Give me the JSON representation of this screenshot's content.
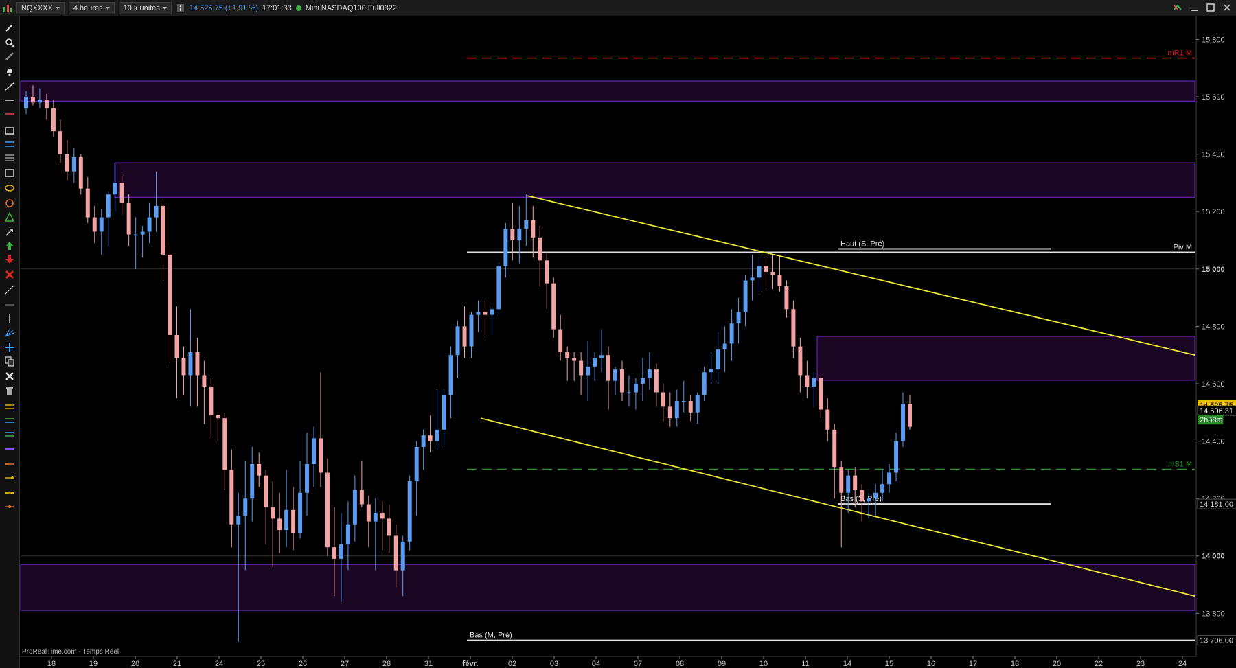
{
  "toolbar": {
    "instrument_code": "NQXXXX",
    "timeframe": "4 heures",
    "units": "10 k unités",
    "price_readout": "14 525,75 (+1,91 %)",
    "time_readout": "17:01:33",
    "instrument_name": "Mini NASDAQ100 Full0322"
  },
  "watermark": "ProRealTime.com - Temps Réel",
  "colors": {
    "background": "#000000",
    "bull": "#5b9cf0",
    "bear": "#f2a3a3",
    "zone_fill": "#1a0522",
    "zone_border": "#7a2ad0",
    "trendline": "#e8e830",
    "pivot_line": "#e0e0e0",
    "r1_line": "#d42020",
    "s1_line": "#2a9a2a",
    "last_price_tag": "#f0c000"
  },
  "chart_data": {
    "type": "candlestick",
    "title": "",
    "ylim": [
      13650,
      15880
    ],
    "y_ticks": [
      "15 800",
      "15 600",
      "15 400",
      "15 200",
      "15 000",
      "14 800",
      "14 600",
      "14 400",
      "14 200",
      "14 000",
      "13 800"
    ],
    "y_tick_values": [
      15800,
      15600,
      15400,
      15200,
      15000,
      14800,
      14600,
      14400,
      14200,
      14000,
      13800
    ],
    "x_tick_labels": [
      "18",
      "19",
      "20",
      "21",
      "24",
      "25",
      "26",
      "27",
      "28",
      "31",
      "févr.",
      "02",
      "03",
      "04",
      "07",
      "08",
      "09",
      "10",
      "11",
      "14",
      "15",
      "16",
      "17",
      "18",
      "20",
      "22",
      "23",
      "24"
    ],
    "price_tags": [
      {
        "label": "14 525,75",
        "value": 14525.75,
        "kind": "last"
      },
      {
        "label": "14 506,31",
        "value": 14506.31,
        "kind": "average"
      },
      {
        "label": "2h58m",
        "value": 14475,
        "kind": "countdown"
      },
      {
        "label": "14 181,00",
        "value": 14181,
        "kind": "low"
      },
      {
        "label": "13 706,00",
        "value": 13706,
        "kind": "monthly_low"
      }
    ],
    "levels": [
      {
        "label": "mR1 M",
        "value": 15735,
        "style": "dashed",
        "color": "#d42020"
      },
      {
        "label": "Piv M",
        "value": 15058,
        "style": "solid",
        "color": "#e0e0e0"
      },
      {
        "label": "Haut (S, Pré)",
        "value": 15070,
        "style": "solid",
        "color": "#e0e0e0"
      },
      {
        "label": "mS1 M",
        "value": 14302,
        "style": "dashed",
        "color": "#2a9a2a"
      },
      {
        "label": "Bas (S, Pré)",
        "value": 14181,
        "style": "solid",
        "color": "#e0e0e0"
      },
      {
        "label": "Bas (M, Pré)",
        "value": 13706,
        "style": "solid",
        "color": "#e0e0e0"
      }
    ],
    "zones": [
      {
        "top": 15655,
        "bottom": 15585
      },
      {
        "top": 15370,
        "bottom": 15250
      },
      {
        "top": 14765,
        "bottom": 14612
      },
      {
        "top": 13970,
        "bottom": 13810
      }
    ],
    "trendlines": [
      {
        "x1": 0.378,
        "y1": 15255,
        "x2": 1.0,
        "y2": 14700
      },
      {
        "x1": 0.345,
        "y1": 14480,
        "x2": 1.0,
        "y2": 13860
      }
    ],
    "ohlc": [
      [
        15560,
        15620,
        15540,
        15600
      ],
      [
        15600,
        15640,
        15570,
        15580
      ],
      [
        15580,
        15630,
        15560,
        15590
      ],
      [
        15590,
        15610,
        15520,
        15560
      ],
      [
        15560,
        15590,
        15460,
        15480
      ],
      [
        15480,
        15520,
        15370,
        15400
      ],
      [
        15400,
        15450,
        15310,
        15340
      ],
      [
        15340,
        15420,
        15300,
        15390
      ],
      [
        15390,
        15400,
        15260,
        15280
      ],
      [
        15280,
        15320,
        15160,
        15180
      ],
      [
        15180,
        15220,
        15090,
        15130
      ],
      [
        15130,
        15210,
        15050,
        15180
      ],
      [
        15180,
        15270,
        15080,
        15260
      ],
      [
        15260,
        15370,
        15200,
        15300
      ],
      [
        15300,
        15330,
        15190,
        15230
      ],
      [
        15230,
        15260,
        15080,
        15120
      ],
      [
        15120,
        15180,
        15000,
        15120
      ],
      [
        15120,
        15150,
        15040,
        15130
      ],
      [
        15130,
        15230,
        15090,
        15180
      ],
      [
        15180,
        15340,
        15130,
        15220
      ],
      [
        15220,
        15240,
        14960,
        15050
      ],
      [
        15050,
        15080,
        14670,
        14770
      ],
      [
        14770,
        14870,
        14550,
        14690
      ],
      [
        14690,
        14730,
        14560,
        14630
      ],
      [
        14630,
        14860,
        14520,
        14710
      ],
      [
        14710,
        14760,
        14520,
        14630
      ],
      [
        14630,
        14680,
        14460,
        14590
      ],
      [
        14590,
        14620,
        14410,
        14490
      ],
      [
        14490,
        14500,
        14400,
        14480
      ],
      [
        14480,
        14500,
        14230,
        14300
      ],
      [
        14300,
        14370,
        14030,
        14110
      ],
      [
        14110,
        14220,
        13700,
        14140
      ],
      [
        14140,
        14330,
        13950,
        14200
      ],
      [
        14200,
        14380,
        14120,
        14320
      ],
      [
        14320,
        14360,
        14240,
        14280
      ],
      [
        14280,
        14300,
        14040,
        14170
      ],
      [
        14170,
        14260,
        13960,
        14130
      ],
      [
        14130,
        14220,
        14010,
        14090
      ],
      [
        14090,
        14300,
        14030,
        14160
      ],
      [
        14160,
        14240,
        14020,
        14080
      ],
      [
        14080,
        14330,
        14060,
        14220
      ],
      [
        14220,
        14430,
        14140,
        14320
      ],
      [
        14320,
        14450,
        14240,
        14410
      ],
      [
        14410,
        14640,
        14240,
        14290
      ],
      [
        14290,
        14340,
        14000,
        14030
      ],
      [
        14030,
        14170,
        13860,
        13990
      ],
      [
        13990,
        14150,
        13840,
        14040
      ],
      [
        14040,
        14190,
        13950,
        14110
      ],
      [
        14110,
        14280,
        14050,
        14230
      ],
      [
        14230,
        14330,
        14170,
        14180
      ],
      [
        14180,
        14210,
        14030,
        14120
      ],
      [
        14120,
        14200,
        13950,
        14150
      ],
      [
        14150,
        14190,
        14020,
        14130
      ],
      [
        14130,
        14180,
        14010,
        14070
      ],
      [
        14070,
        14110,
        13890,
        13950
      ],
      [
        13950,
        14070,
        13860,
        14050
      ],
      [
        14050,
        14280,
        14020,
        14260
      ],
      [
        14260,
        14400,
        14140,
        14380
      ],
      [
        14380,
        14440,
        14300,
        14420
      ],
      [
        14420,
        14490,
        14360,
        14400
      ],
      [
        14400,
        14580,
        14370,
        14440
      ],
      [
        14440,
        14580,
        14380,
        14560
      ],
      [
        14560,
        14730,
        14480,
        14700
      ],
      [
        14700,
        14820,
        14620,
        14800
      ],
      [
        14800,
        14870,
        14690,
        14730
      ],
      [
        14730,
        14850,
        14690,
        14840
      ],
      [
        14840,
        14890,
        14780,
        14850
      ],
      [
        14850,
        14890,
        14760,
        14840
      ],
      [
        14840,
        14870,
        14770,
        14860
      ],
      [
        14860,
        15020,
        14840,
        15010
      ],
      [
        15010,
        15160,
        14970,
        15140
      ],
      [
        15140,
        15230,
        15030,
        15100
      ],
      [
        15100,
        15220,
        15020,
        15140
      ],
      [
        15140,
        15260,
        15080,
        15170
      ],
      [
        15170,
        15220,
        15040,
        15110
      ],
      [
        15110,
        15150,
        14940,
        15030
      ],
      [
        15030,
        15060,
        14860,
        14950
      ],
      [
        14950,
        14970,
        14760,
        14790
      ],
      [
        14790,
        14840,
        14680,
        14710
      ],
      [
        14710,
        14730,
        14610,
        14690
      ],
      [
        14690,
        14710,
        14610,
        14680
      ],
      [
        14680,
        14710,
        14560,
        14630
      ],
      [
        14630,
        14750,
        14540,
        14660
      ],
      [
        14660,
        14710,
        14610,
        14690
      ],
      [
        14690,
        14790,
        14640,
        14700
      ],
      [
        14700,
        14730,
        14510,
        14610
      ],
      [
        14610,
        14660,
        14560,
        14650
      ],
      [
        14650,
        14680,
        14540,
        14570
      ],
      [
        14570,
        14630,
        14520,
        14570
      ],
      [
        14570,
        14620,
        14510,
        14600
      ],
      [
        14600,
        14690,
        14540,
        14620
      ],
      [
        14620,
        14710,
        14580,
        14650
      ],
      [
        14650,
        14670,
        14520,
        14570
      ],
      [
        14570,
        14600,
        14470,
        14520
      ],
      [
        14520,
        14570,
        14450,
        14480
      ],
      [
        14480,
        14580,
        14450,
        14540
      ],
      [
        14540,
        14610,
        14500,
        14540
      ],
      [
        14540,
        14560,
        14470,
        14500
      ],
      [
        14500,
        14570,
        14460,
        14560
      ],
      [
        14560,
        14660,
        14540,
        14640
      ],
      [
        14640,
        14710,
        14600,
        14650
      ],
      [
        14650,
        14780,
        14600,
        14720
      ],
      [
        14720,
        14800,
        14640,
        14740
      ],
      [
        14740,
        14860,
        14680,
        14810
      ],
      [
        14810,
        14900,
        14740,
        14850
      ],
      [
        14850,
        14980,
        14800,
        14960
      ],
      [
        14960,
        15050,
        14890,
        14970
      ],
      [
        14970,
        15040,
        14920,
        15010
      ],
      [
        15010,
        15040,
        14940,
        14990
      ],
      [
        14990,
        15050,
        14930,
        14980
      ],
      [
        14980,
        15050,
        14920,
        14940
      ],
      [
        14940,
        14960,
        14830,
        14860
      ],
      [
        14860,
        14890,
        14690,
        14730
      ],
      [
        14730,
        14760,
        14570,
        14630
      ],
      [
        14630,
        14680,
        14550,
        14590
      ],
      [
        14590,
        14640,
        14520,
        14620
      ],
      [
        14620,
        14630,
        14480,
        14510
      ],
      [
        14510,
        14550,
        14400,
        14440
      ],
      [
        14440,
        14460,
        14200,
        14310
      ],
      [
        14310,
        14330,
        14030,
        14220
      ],
      [
        14220,
        14300,
        14150,
        14280
      ],
      [
        14280,
        14310,
        14170,
        14230
      ],
      [
        14230,
        14250,
        14120,
        14190
      ],
      [
        14190,
        14220,
        14130,
        14200
      ],
      [
        14200,
        14250,
        14140,
        14220
      ],
      [
        14220,
        14300,
        14190,
        14250
      ],
      [
        14250,
        14320,
        14220,
        14290
      ],
      [
        14290,
        14430,
        14260,
        14400
      ],
      [
        14400,
        14570,
        14380,
        14530
      ],
      [
        14530,
        14560,
        14440,
        14450
      ]
    ]
  }
}
